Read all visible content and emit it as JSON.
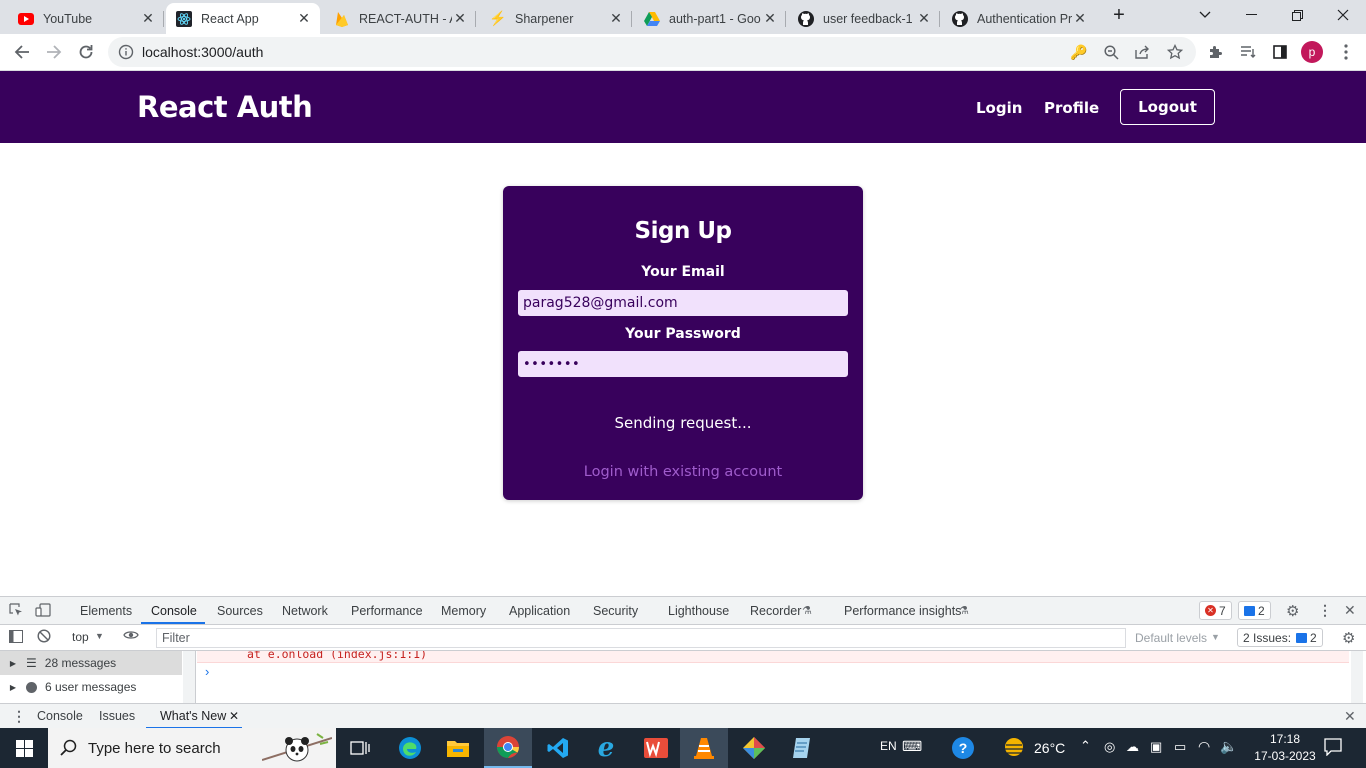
{
  "browser": {
    "tabs": [
      {
        "title": "YouTube",
        "icon": "youtube-icon",
        "color": "#ff0000"
      },
      {
        "title": "React App",
        "icon": "react-icon",
        "color": "#61dafb",
        "active": true
      },
      {
        "title": "REACT-AUTH - A",
        "icon": "firebase-icon",
        "color": "#ffca28"
      },
      {
        "title": "Sharpener",
        "icon": "sharpener-icon",
        "color": "#e53935"
      },
      {
        "title": "auth-part1 - Goo",
        "icon": "google-drive-icon",
        "color": "#0f9d58"
      },
      {
        "title": "user feedback-1",
        "icon": "github-icon",
        "color": "#202124"
      },
      {
        "title": "Authentication Pr",
        "icon": "github-icon",
        "color": "#202124"
      }
    ],
    "url": "localhost:3000/auth",
    "profile_initial": "p"
  },
  "app": {
    "brand": "React Auth",
    "nav": {
      "login": "Login",
      "profile": "Profile",
      "logout": "Logout"
    },
    "form": {
      "title": "Sign Up",
      "email_label": "Your Email",
      "email_value": "parag528@gmail.com",
      "password_label": "Your Password",
      "password_value": "•••••••",
      "status": "Sending request...",
      "toggle": "Login with existing account"
    },
    "colors": {
      "primary": "#38015c",
      "input_bg": "#f1e1fc",
      "link": "#9f5ccc"
    }
  },
  "devtools": {
    "tabs": [
      "Elements",
      "Console",
      "Sources",
      "Network",
      "Performance",
      "Memory",
      "Application",
      "Security",
      "Lighthouse",
      "Recorder",
      "Performance insights"
    ],
    "errors": "7",
    "messages": "2",
    "context": "top",
    "filter_placeholder": "Filter",
    "levels": "Default levels",
    "issues_label": "2 Issues:",
    "issues_count": "2",
    "sidebar": {
      "messages": "28 messages",
      "user_messages": "6 user messages"
    },
    "error_line": "at e.onload (index.js:1:1)",
    "drawer_tabs": [
      "Console",
      "Issues",
      "What's New"
    ]
  },
  "taskbar": {
    "search_placeholder": "Type here to search",
    "language": "EN",
    "temperature": "26°C",
    "time": "17:18",
    "date": "17-03-2023"
  }
}
